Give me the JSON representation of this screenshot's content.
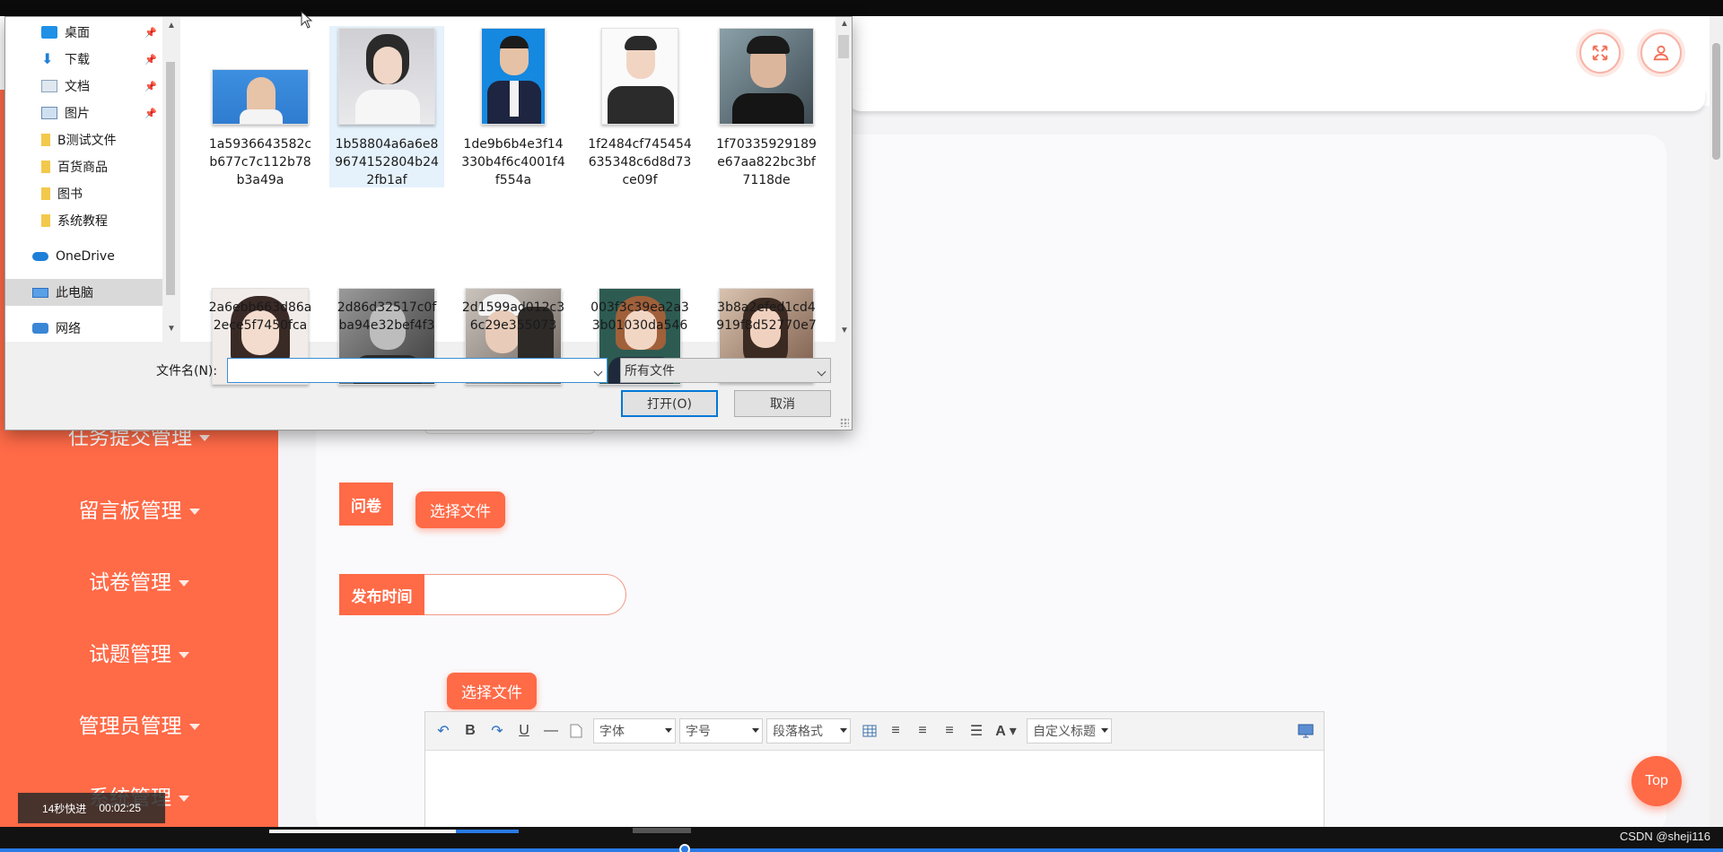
{
  "sidebar": {
    "items": [
      {
        "label": "任务提交管理"
      },
      {
        "label": "留言板管理"
      },
      {
        "label": "试卷管理"
      },
      {
        "label": "试题管理"
      },
      {
        "label": "管理员管理"
      },
      {
        "label": "系统管理"
      }
    ]
  },
  "form": {
    "questionnaire_label": "问卷",
    "choose_file_label": "选择文件",
    "publish_time_label": "发布时间",
    "choose_file_label_2": "选择文件"
  },
  "editor": {
    "font_family": "字体",
    "font_size": "字号",
    "paragraph": "段落格式",
    "custom_title": "自定义标题"
  },
  "top_button": "Top",
  "video": {
    "speed_text": "14秒快进",
    "time": "00:02:25",
    "watermark": "CSDN @sheji116"
  },
  "dialog": {
    "nav": [
      {
        "label": "桌面",
        "icon": "desktop-icon",
        "pinned": true
      },
      {
        "label": "下载",
        "icon": "download-icon",
        "pinned": true
      },
      {
        "label": "文档",
        "icon": "document-icon",
        "pinned": true
      },
      {
        "label": "图片",
        "icon": "picture-icon",
        "pinned": true
      },
      {
        "label": "B测试文件",
        "icon": "folder-icon",
        "pinned": false
      },
      {
        "label": "百货商品",
        "icon": "folder-icon",
        "pinned": false
      },
      {
        "label": "图书",
        "icon": "folder-icon",
        "pinned": false
      },
      {
        "label": "系统教程",
        "icon": "folder-icon",
        "pinned": false
      },
      {
        "label": "OneDrive",
        "icon": "cloud-icon",
        "pinned": false
      },
      {
        "label": "此电脑",
        "icon": "computer-icon",
        "pinned": false
      },
      {
        "label": "网络",
        "icon": "network-icon",
        "pinned": false
      }
    ],
    "files": [
      {
        "name": "1a5936643582cb677c7c112b78b3a49a"
      },
      {
        "name": "1b58804a6a6e89674152804b242fb1af"
      },
      {
        "name": "1de9b6b4e3f14330b4f6c4001f4f554a"
      },
      {
        "name": "1f2484cf745454635348c6d8d73ce09f"
      },
      {
        "name": "1f70335929189e67aa822bc3bf7118de"
      },
      {
        "name": "2a6ebb663d86a2ece5f7450fca"
      },
      {
        "name": "2d86d32517c0fba94e32bef4f3"
      },
      {
        "name": "2d1599ad012c36c29e355073"
      },
      {
        "name": "003f3c39ea2a33b01030da546"
      },
      {
        "name": "3b8a2efed1cd4919f8d52770e7"
      }
    ],
    "filename_label": "文件名(N):",
    "filename_value": "",
    "filetype": "所有文件",
    "open_button": "打开(O)",
    "cancel_button": "取消"
  },
  "colors": {
    "accent": "#ff6a47",
    "dialog_bg": "#f0f0f0",
    "highlight": "#e5f1fb"
  }
}
